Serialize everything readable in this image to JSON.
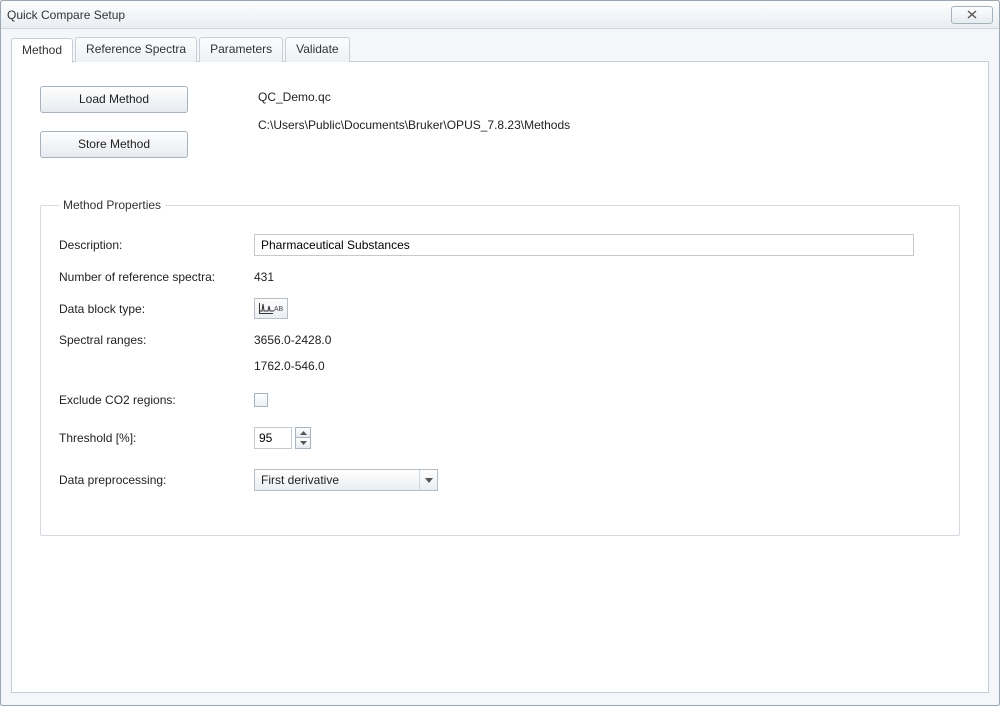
{
  "window": {
    "title": "Quick Compare Setup"
  },
  "tabs": [
    {
      "label": "Method"
    },
    {
      "label": "Reference Spectra"
    },
    {
      "label": "Parameters"
    },
    {
      "label": "Validate"
    }
  ],
  "buttons": {
    "load_method": "Load Method",
    "store_method": "Store Method"
  },
  "method_info": {
    "filename": "QC_Demo.qc",
    "path": "C:\\Users\\Public\\Documents\\Bruker\\OPUS_7.8.23\\Methods"
  },
  "properties": {
    "legend": "Method Properties",
    "labels": {
      "description": "Description:",
      "num_ref_spectra": "Number of reference spectra:",
      "data_block_type": "Data block type:",
      "spectral_ranges": "Spectral ranges:",
      "exclude_co2": "Exclude CO2 regions:",
      "threshold": "Threshold [%]:",
      "data_preprocessing": "Data preprocessing:"
    },
    "values": {
      "description": "Pharmaceutical Substances",
      "num_ref_spectra": "431",
      "data_block_icon_label": "AB",
      "spectral_ranges": [
        "3656.0-2428.0",
        "1762.0-546.0"
      ],
      "exclude_co2": false,
      "threshold": "95",
      "data_preprocessing": "First derivative"
    }
  }
}
